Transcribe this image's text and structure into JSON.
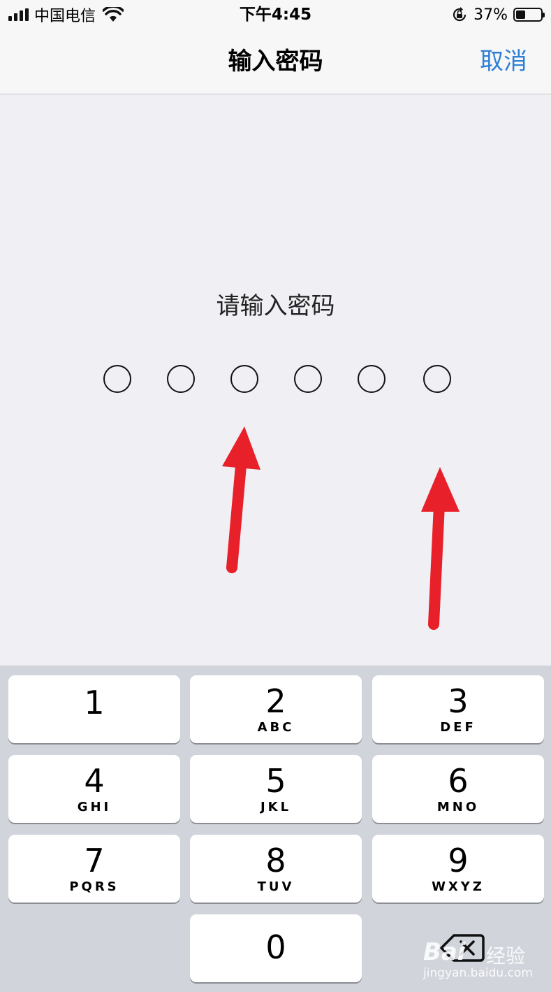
{
  "status_bar": {
    "carrier": "中国电信",
    "time": "下午4:45",
    "battery_percent_text": "37%",
    "battery_level": 0.37
  },
  "nav": {
    "title": "输入密码",
    "cancel_label": "取消"
  },
  "prompt": "请输入密码",
  "passcode_length": 6,
  "colors": {
    "accent": "#2e7fd6",
    "arrow": "#e8202a",
    "background": "#efeff4",
    "keypad_bg": "#d1d4da"
  },
  "keypad": {
    "keys": [
      {
        "num": "1",
        "letters": ""
      },
      {
        "num": "2",
        "letters": "ABC"
      },
      {
        "num": "3",
        "letters": "DEF"
      },
      {
        "num": "4",
        "letters": "GHI"
      },
      {
        "num": "5",
        "letters": "JKL"
      },
      {
        "num": "6",
        "letters": "MNO"
      },
      {
        "num": "7",
        "letters": "PQRS"
      },
      {
        "num": "8",
        "letters": "TUV"
      },
      {
        "num": "9",
        "letters": "WXYZ"
      },
      {
        "num": "0",
        "letters": ""
      }
    ],
    "delete_icon": "backspace-icon"
  },
  "watermark": {
    "logo": "Bai",
    "text": "经验",
    "url": "jingyan.baidu.com"
  }
}
